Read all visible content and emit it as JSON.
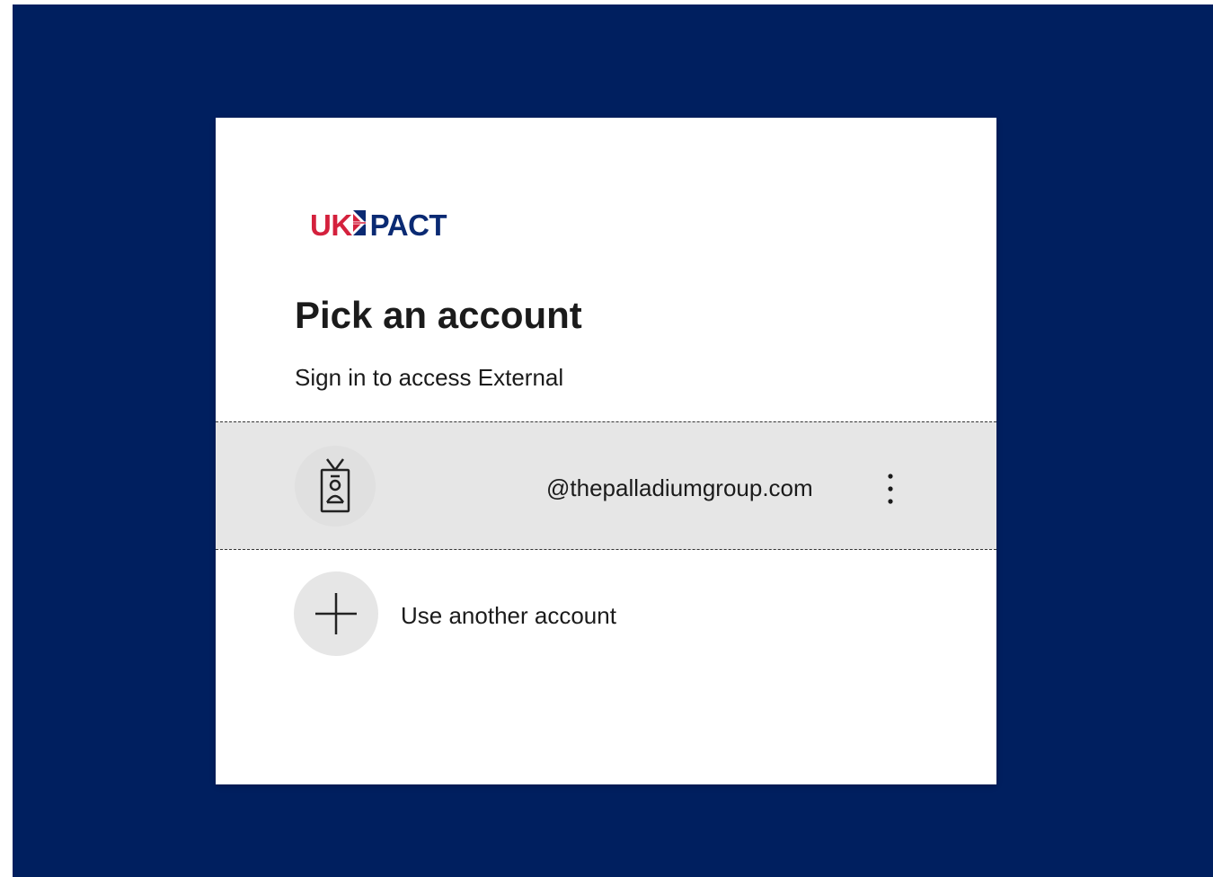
{
  "logo": {
    "brand_left": "UK",
    "brand_right": "PACT"
  },
  "heading": {
    "title": "Pick an account",
    "subtitle": "Sign in to access External"
  },
  "account": {
    "email": "@thepalladiumgroup.com",
    "avatar_icon": "badge-person-icon",
    "more_icon": "more-options-icon"
  },
  "add_account": {
    "label": "Use another account",
    "icon": "plus-icon"
  },
  "colors": {
    "background": "#001f5f",
    "card": "#ffffff",
    "tile_highlight": "#e6e6e6",
    "brand_red": "#d4213d",
    "brand_blue": "#0a2a73"
  }
}
